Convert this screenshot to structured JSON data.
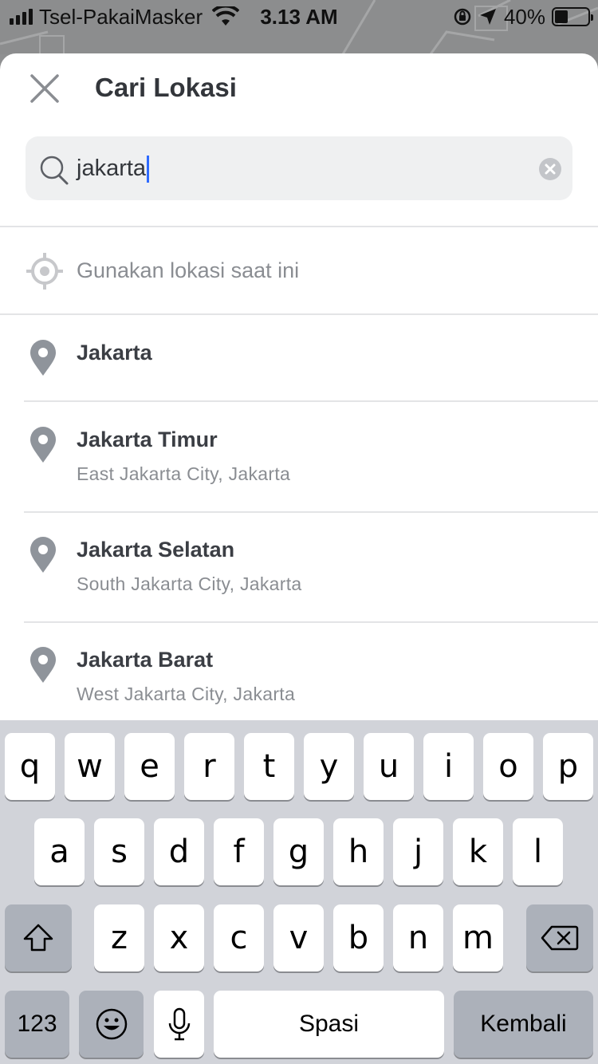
{
  "status_bar": {
    "carrier": "Tsel-PakaiMasker",
    "time": "3.13 AM",
    "battery": "40%"
  },
  "header": {
    "title": "Cari Lokasi",
    "close_icon": "close-icon"
  },
  "search": {
    "value": "jakarta",
    "icon": "search-icon",
    "clear_icon": "clear-icon"
  },
  "current_location": {
    "label": "Gunakan lokasi saat ini",
    "icon": "location-target-icon"
  },
  "results": [
    {
      "name": "Jakarta",
      "subtitle": ""
    },
    {
      "name": "Jakarta Timur",
      "subtitle": "East Jakarta City, Jakarta"
    },
    {
      "name": "Jakarta Selatan",
      "subtitle": "South Jakarta City, Jakarta"
    },
    {
      "name": "Jakarta Barat",
      "subtitle": "West Jakarta City, Jakarta"
    }
  ],
  "keyboard": {
    "row1": [
      "q",
      "w",
      "e",
      "r",
      "t",
      "y",
      "u",
      "i",
      "o",
      "p"
    ],
    "row2": [
      "a",
      "s",
      "d",
      "f",
      "g",
      "h",
      "j",
      "k",
      "l"
    ],
    "row3": [
      "z",
      "x",
      "c",
      "v",
      "b",
      "n",
      "m"
    ],
    "numbers_label": "123",
    "space_label": "Spasi",
    "return_label": "Kembali",
    "shift_icon": "shift-icon",
    "backspace_icon": "backspace-icon",
    "emoji_icon": "emoji-icon",
    "mic_icon": "microphone-icon"
  },
  "colors": {
    "caret": "#2f6bff",
    "search_bg": "#eff0f1",
    "keyboard_bg": "#d1d3d9"
  }
}
